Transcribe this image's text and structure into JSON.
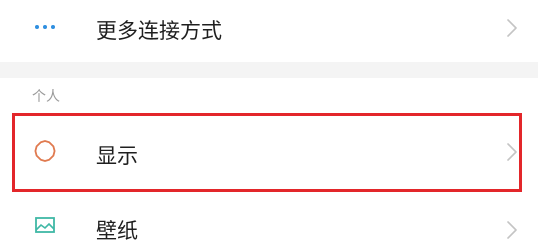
{
  "settings": {
    "more_connections": {
      "label": "更多连接方式",
      "icon": "more-dots-icon"
    },
    "section_personal": {
      "header": "个人"
    },
    "display": {
      "label": "显示",
      "icon": "sun-gear-icon"
    },
    "wallpaper": {
      "label": "壁纸",
      "icon": "wallpaper-icon"
    }
  },
  "colors": {
    "accent_blue": "#2f8fe0",
    "display_icon_orange": "#e07a4f",
    "wallpaper_icon_teal": "#3fb8a6",
    "highlight_red": "#e3262a"
  }
}
